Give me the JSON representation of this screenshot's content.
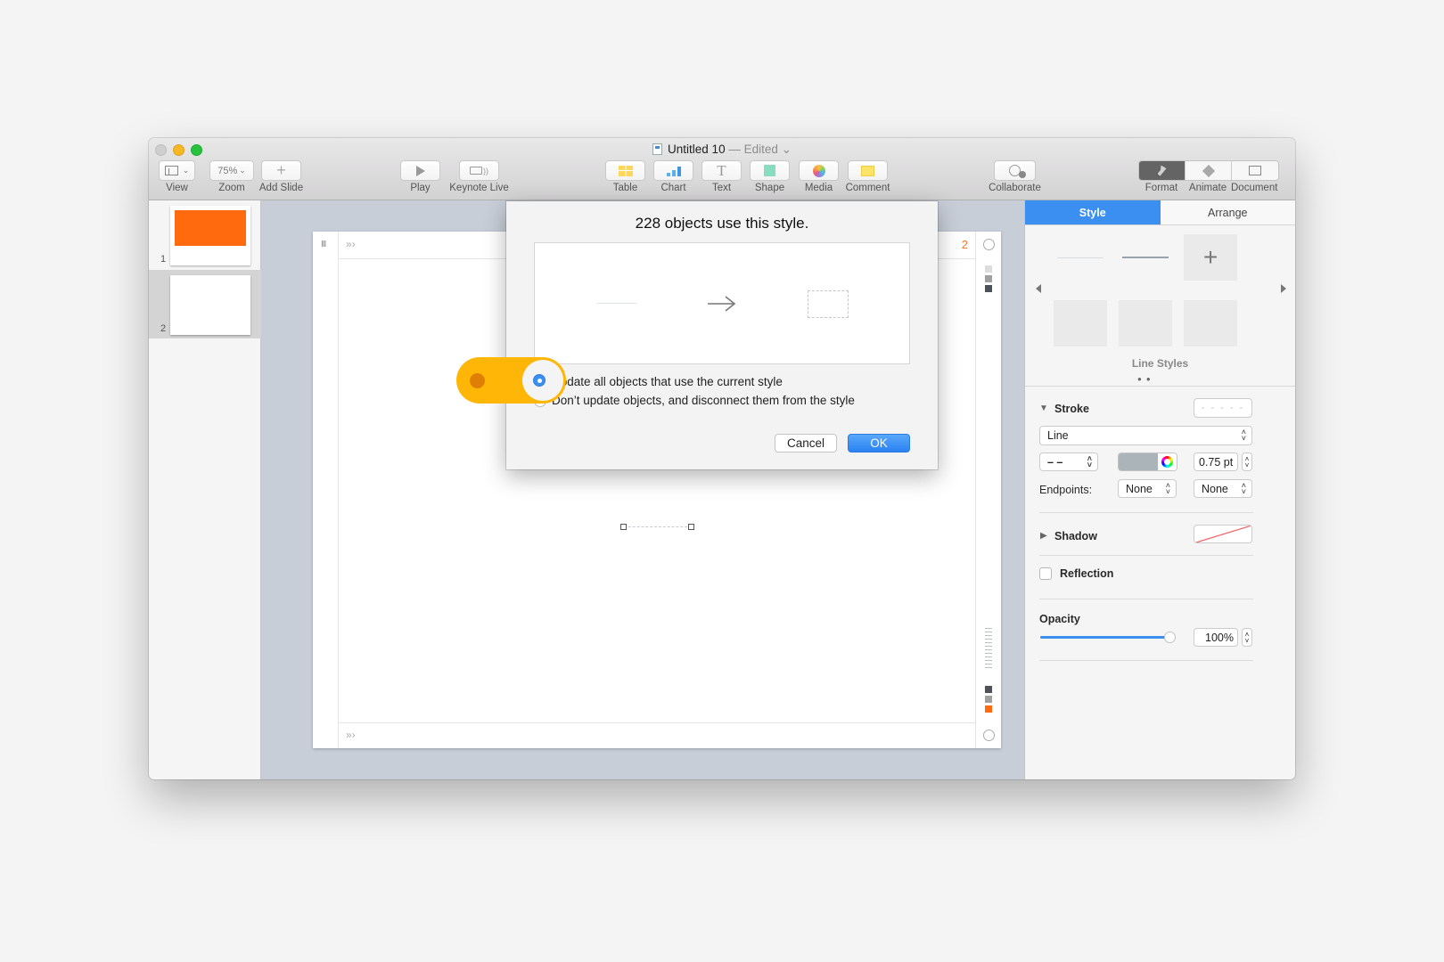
{
  "window": {
    "title": "Untitled 10",
    "title_separator": " — ",
    "title_status": "Edited",
    "title_chevron": "⌄"
  },
  "toolbar": {
    "view_label": "View",
    "zoom_label": "Zoom",
    "zoom_value": "75%",
    "add_slide_label": "Add Slide",
    "play_label": "Play",
    "keynote_live_label": "Keynote Live",
    "table_label": "Table",
    "chart_label": "Chart",
    "text_label": "Text",
    "shape_label": "Shape",
    "media_label": "Media",
    "comment_label": "Comment",
    "collaborate_label": "Collaborate",
    "format_label": "Format",
    "animate_label": "Animate",
    "document_label": "Document"
  },
  "navigator": {
    "slides": [
      {
        "number": "1",
        "has_orange_box": true
      },
      {
        "number": "2",
        "has_orange_box": false,
        "selected": true
      }
    ]
  },
  "canvas": {
    "slide_number_indicator": "2",
    "ruler_marker": "»›",
    "ruler_left_marker": "III"
  },
  "dialog": {
    "title": "228 objects use this style.",
    "options": [
      {
        "label": "Update all objects that use the current style",
        "checked": true
      },
      {
        "label": "Don’t update objects, and disconnect them from the style",
        "checked": false
      }
    ],
    "cancel_label": "Cancel",
    "ok_label": "OK"
  },
  "inspector": {
    "tabs": [
      {
        "label": "Style",
        "active": true
      },
      {
        "label": "Arrange",
        "active": false
      }
    ],
    "line_styles_label": "Line Styles",
    "stroke": {
      "title": "Stroke",
      "type": "Line",
      "dash_pattern": "– –",
      "color": "#aab4b9",
      "width": "0.75 pt",
      "endpoints_label": "Endpoints:",
      "endpoint_start": "None",
      "endpoint_end": "None"
    },
    "shadow": {
      "title": "Shadow"
    },
    "reflection": {
      "label": "Reflection",
      "checked": false
    },
    "opacity": {
      "label": "Opacity",
      "value": "100%",
      "fraction": 1.0
    }
  },
  "colors": {
    "accent": "#3a8ff0",
    "orange": "#ff6a0f",
    "toggle_yellow": "#ffb606"
  }
}
